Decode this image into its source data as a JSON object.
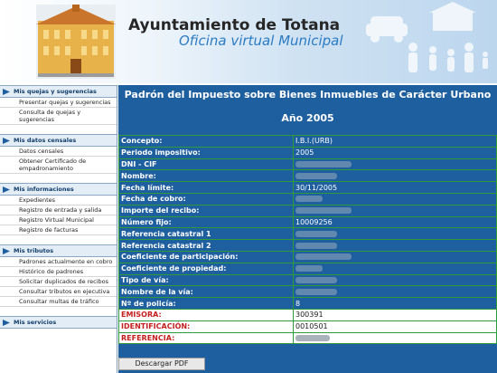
{
  "header": {
    "title": "Ayuntamiento de Totana",
    "subtitle": "Oficina virtual Municipal"
  },
  "sidebar": {
    "sections": [
      {
        "label": "Mis quejas y sugerencias",
        "items": [
          "Presentar quejas y sugerencias",
          "Consulta de quejas y sugerencias"
        ]
      },
      {
        "label": "Mis datos censales",
        "items": [
          "Datos censales",
          "Obtener Certificado de empadronamiento"
        ]
      },
      {
        "label": "Mis informaciones",
        "items": [
          "Expedientes",
          "Registro de entrada y salida",
          "Registro Virtual Municipal",
          "Registro de facturas"
        ]
      },
      {
        "label": "Mis tributos",
        "items": [
          "Padrones actualmente en cobro",
          "Histórico de padrones",
          "Solicitar duplicados de recibos",
          "Consultar tributos en ejecutiva",
          "Consultar multas de tráfico"
        ]
      },
      {
        "label": "Mis servicios",
        "items": []
      }
    ]
  },
  "main": {
    "title": "Padrón del Impuesto sobre Bienes Inmuebles de Carácter Urbano",
    "year": "Año 2005",
    "rows": [
      {
        "label": "Concepto:",
        "value": "I.B.I.(URB)"
      },
      {
        "label": "Periodo impositivo:",
        "value": "2005"
      },
      {
        "label": "DNI - CIF",
        "value": ""
      },
      {
        "label": "Nombre:",
        "value": ""
      },
      {
        "label": "Fecha límite:",
        "value": "30/11/2005"
      },
      {
        "label": "Fecha de cobro:",
        "value": ""
      },
      {
        "label": "Importe del recibo:",
        "value": ""
      },
      {
        "label": "Número fijo:",
        "value": "10009256"
      },
      {
        "label": "Referencia catastral 1",
        "value": ""
      },
      {
        "label": "Referencia catastral 2",
        "value": ""
      },
      {
        "label": "Coeficiente de participación:",
        "value": ""
      },
      {
        "label": "Coeficiente de propiedad:",
        "value": ""
      },
      {
        "label": "Tipo de vía:",
        "value": ""
      },
      {
        "label": "Nombre de la vía:",
        "value": ""
      },
      {
        "label": "Nº de policía:",
        "value": "8"
      }
    ],
    "highlight_rows": [
      {
        "label": "EMISORA:",
        "value": "300391"
      },
      {
        "label": "IDENTIFICACIÓN:",
        "value": "0010501"
      },
      {
        "label": "REFERENCIA:",
        "value": ""
      }
    ],
    "download_button": "Descargar PDF"
  },
  "colors": {
    "main_bg": "#1e5f9f",
    "row_border": "#2d9a3c",
    "highlight_label": "#c41e1e"
  }
}
